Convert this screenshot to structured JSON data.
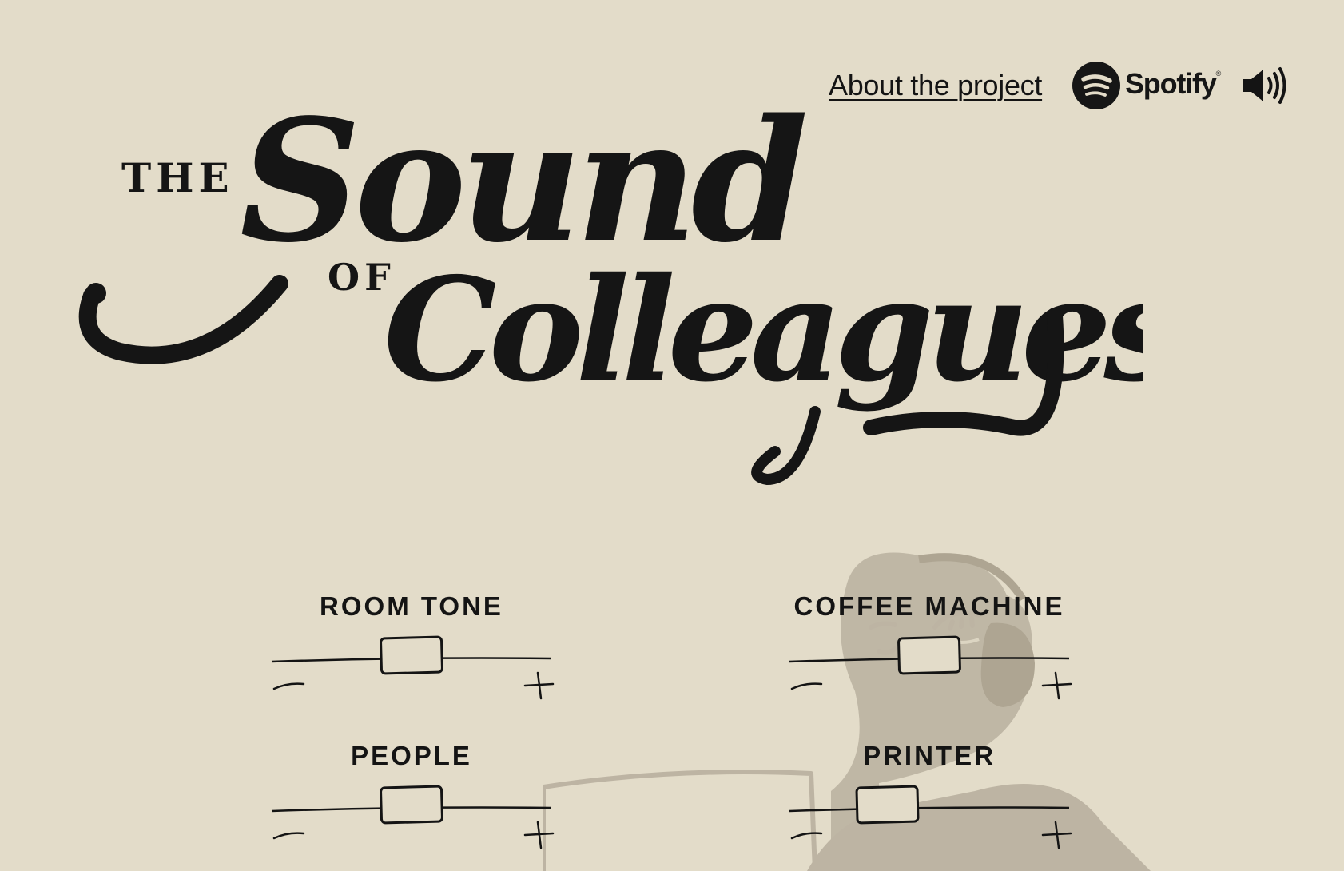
{
  "header": {
    "about_link": "About the project",
    "spotify_wordmark": "Spotify",
    "spotify_icon": "spotify-logo-icon",
    "volume_icon": "speaker-volume-icon"
  },
  "hero": {
    "title": "THE Sound OF Colleagues",
    "title_words": [
      "THE",
      "Sound",
      "OF",
      "Colleagues"
    ]
  },
  "mixer": {
    "channels": [
      {
        "label": "ROOM TONE",
        "level": 0.5
      },
      {
        "label": "COFFEE MACHINE",
        "level": 0.5
      },
      {
        "label": "PEOPLE",
        "level": 0.5
      },
      {
        "label": "PRINTER",
        "level": 0.35
      }
    ],
    "min_symbol": "−",
    "max_symbol": "+"
  },
  "colors": {
    "background": "#e3dcc9",
    "ink": "#141414",
    "illustration": "#bdb4a3"
  }
}
